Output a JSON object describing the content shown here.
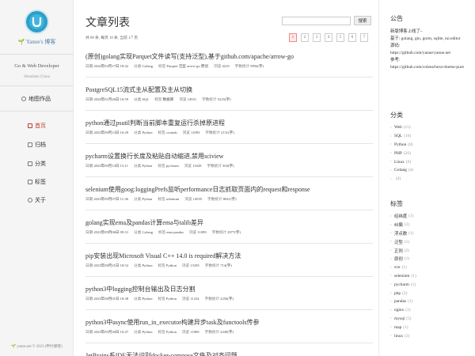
{
  "site": {
    "title": "Yanue's 博客",
    "role": "Go & Web Developer",
    "location": "Shenzhen China",
    "map_link": "地图作品",
    "footer": "yanue.net © 2023 (申叶摩客)"
  },
  "nav": [
    {
      "label": "首页",
      "active": true
    },
    {
      "label": "归档",
      "active": false
    },
    {
      "label": "分类",
      "active": false
    },
    {
      "label": "标签",
      "active": false
    },
    {
      "label": "关于",
      "active": false
    }
  ],
  "main": {
    "title": "文章列表",
    "search_button": "搜索",
    "summary": "共 88 条, 每页 10 条, 当前 1/7 页",
    "pages": [
      "1",
      "2",
      "3",
      "4",
      "5",
      "6",
      "7"
    ],
    "current_page": "1",
    "meta_labels": {
      "date": "日期",
      "category": "分类",
      "tags": "标签",
      "views": "浏览",
      "words": "字数统计"
    },
    "posts": [
      {
        "title": "(原创)golang实现Parquet文件读写(支持泛型),基于github.com/apache/arrow-go",
        "date": "2024年03月17日 18:42",
        "category": "Golang",
        "tags": "Parquet 泛型 arrow-go 原创",
        "views": "4210",
        "words": "9956(字)"
      },
      {
        "title": "PostgreSQL15流式主从配置及主从切换",
        "date": "2024年01月26日 16:59",
        "category": "SQL",
        "tags": "数据库",
        "views": "14931",
        "words": "5225(字)"
      },
      {
        "title": "python通过psutil判断当前脚本重复运行杀掉原进程",
        "date": "2023年09月13日 16:29",
        "category": "Python",
        "tags": "crontab",
        "views": "11093",
        "words": "2131(字)"
      },
      {
        "title": "pycharm设置换行长度及粘贴自动缩进,禁用sciview",
        "date": "2023年09月13日 15:11",
        "category": "Python",
        "tags": "pycharm",
        "views": "11629",
        "words": "304(字)"
      },
      {
        "title": "selenium使用goog:loggingPrefs监听performance日志抓取页面内的request和response",
        "date": "2023年09月07日 11:36",
        "category": "Python",
        "tags": "selenium",
        "views": "14935",
        "words": "8041(字)"
      },
      {
        "title": "golang实现ema及pandas计算ema与talib差异",
        "date": "2023年09月06日 09:31",
        "category": "Golang",
        "tags": "ema pandas",
        "views": "11099",
        "words": "2977(字)"
      },
      {
        "title": "pip安装出现Microsoft Visual C++ 14.0 is required解决方法",
        "date": "2023年08月21日 18:52",
        "category": "Python",
        "tags": "Python",
        "views": "13185",
        "words": "714(字)"
      },
      {
        "title": "python3中logging控制台输出及日志分割",
        "date": "2023年08月01日 18:38",
        "category": "Python",
        "tags": "Python",
        "views": "11234",
        "words": "2256(字)"
      },
      {
        "title": "python3中async使用run_in_executor构建异步task及functools传参",
        "date": "2023年05月30日 10:47",
        "category": "Python",
        "tags": "Python",
        "views": "11069",
        "words": "2249(字)"
      },
      {
        "title": "JetBrains系IDE无法识别docker-compose文件及对齐问题",
        "date": "",
        "category": "",
        "tags": "",
        "views": "",
        "words": ""
      }
    ]
  },
  "sidebar": {
    "notice_title": "公告",
    "notice_lines": [
      "新版博客上线了~",
      "基于: golang, gin, gorm, sqlite, tui.editor",
      "源码:",
      "https://github.com/yanue/yanue.net",
      "参考:",
      "https://github.com/coleea/hexo-theme-pure"
    ],
    "categories_title": "分类",
    "categories": [
      {
        "name": "Web",
        "count": "(15)"
      },
      {
        "name": "SQL",
        "count": "(10)"
      },
      {
        "name": "Python",
        "count": "(8)"
      },
      {
        "name": "PHP",
        "count": "(20)"
      },
      {
        "name": "Linux",
        "count": "(9)"
      },
      {
        "name": "Golang",
        "count": "(4)"
      },
      {
        "name": "",
        "count": "(4)"
      }
    ],
    "tags_title": "标签",
    "tags": [
      {
        "name": "经纬度",
        "count": "(1)"
      },
      {
        "name": "纠偏",
        "count": "(2)"
      },
      {
        "name": "浮点数",
        "count": "(1)"
      },
      {
        "name": "泛型",
        "count": "(1)"
      },
      {
        "name": "正则",
        "count": "(2)"
      },
      {
        "name": "原创",
        "count": "(1)"
      },
      {
        "name": "svn",
        "count": "(1)"
      },
      {
        "name": "selenium",
        "count": "(1)"
      },
      {
        "name": "pycharm",
        "count": "(1)"
      },
      {
        "name": "php",
        "count": "(3)"
      },
      {
        "name": "pandas",
        "count": "(1)"
      },
      {
        "name": "nginx",
        "count": "(1)"
      },
      {
        "name": "mysql",
        "count": "(5)"
      },
      {
        "name": "map",
        "count": "(1)"
      },
      {
        "name": "linux",
        "count": "(3)"
      }
    ]
  },
  "colors": {
    "accent": "#c0392b",
    "logo": "#2b9fc8",
    "leaf": "#5aa447"
  }
}
